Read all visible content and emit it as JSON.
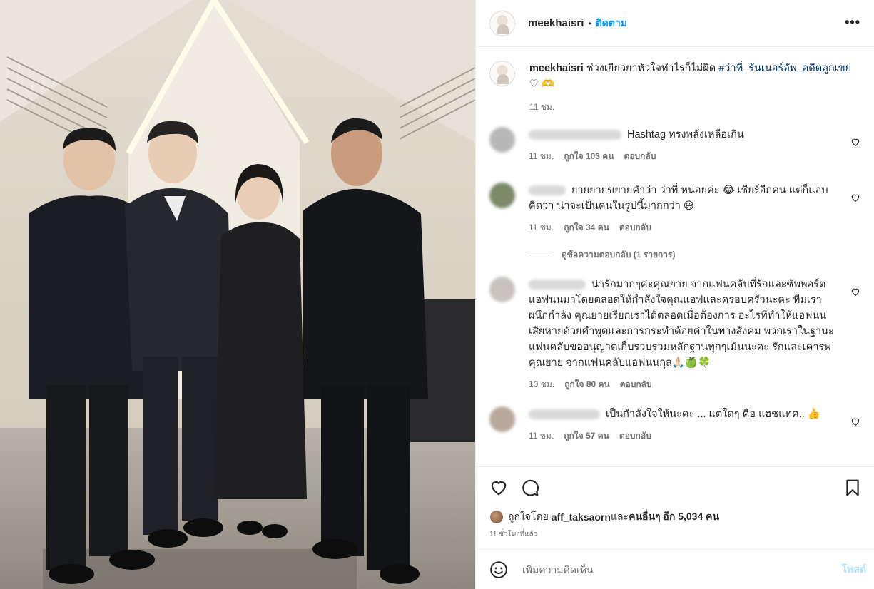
{
  "post": {
    "username": "meekhaisri",
    "follow_label": "ติดตาม",
    "header_separator": "•",
    "more_label": "•••",
    "photo_alt": "ภาพถ่ายหมู่สี่คนในชุดสีดำ"
  },
  "caption": {
    "username": "meekhaisri",
    "text": " ช่วงเยียวยาหัวใจทำไรก็ไม่ผิด ",
    "hashtag": "#ว่าที่_รันเนอร์อัพ_อดีตลูกเขย",
    "suffix": " ♡ 🫶",
    "time": "11 ชม."
  },
  "comments": [
    {
      "text": "Hashtag ทรงพลังเหลือเกิน",
      "time": "11 ชม.",
      "likes": "ถูกใจ 103 คน",
      "reply": "ตอบกลับ",
      "avatar_color": "#b8b8b8"
    },
    {
      "text": "ยายยายขยายคำว่า ว่าที่ หน่อยค่ะ 😂 เชียร์อีกคน แต่ก็แอบคิดว่า น่าจะเป็นคนในรูปนี้มากกว่า 😅",
      "time": "11 ชม.",
      "likes": "ถูกใจ 34 คน",
      "reply": "ตอบกลับ",
      "avatar_color": "#7c8a6a"
    },
    {
      "text": "น่ารักมากๆค่ะคุณยาย จากแฟนคลับที่รักและซัพพอร์ตแอฟนนมาโดยตลอดให้กำลังใจคุณแอฟและครอบครัวนะคะ ทีมเราผนึกกำลัง คุณยายเรียกเราได้ตลอดเมื่อต้องการ อะไรที่ทำให้แอฟนนเสียหายด้วยคำพูดและการกระทำด้อยค่าในทางสังคม พวกเราในฐานะแฟนคลับขออนุญาตเก็บรวบรวมหลักฐานทุกๆเม้นนะคะ รักและเคารพคุณยาย จากแฟนคลับแอฟนนกุล🙏🏻🍏🍀",
      "time": "10 ชม.",
      "likes": "ถูกใจ 80 คน",
      "reply": "ตอบกลับ",
      "avatar_color": "#c7c2bd"
    },
    {
      "text": "เป็นกำลังใจให้นะคะ ... แต่ใดๆ คือ แฮชแทค.. 👍",
      "time": "11 ชม.",
      "likes": "ถูกใจ 57 คน",
      "reply": "ตอบกลับ",
      "avatar_color": "#b9a99b"
    }
  ],
  "view_replies": "ดูข้อความตอบกลับ (1 รายการ)",
  "likes": {
    "prefix": "ถูกใจโดย ",
    "user": "aff_taksaorn",
    "middle": " และ",
    "others": "คนอื่นๆ อีก 5,034 คน"
  },
  "time_ago": "11 ชั่วโมงที่แล้ว",
  "composer": {
    "placeholder": "เพิ่มความคิดเห็น",
    "post_label": "โพสต์"
  },
  "icons": {
    "like": "heart-icon",
    "comment": "comment-icon",
    "save": "bookmark-icon",
    "emoji": "emoji-icon",
    "more": "more-icon"
  }
}
